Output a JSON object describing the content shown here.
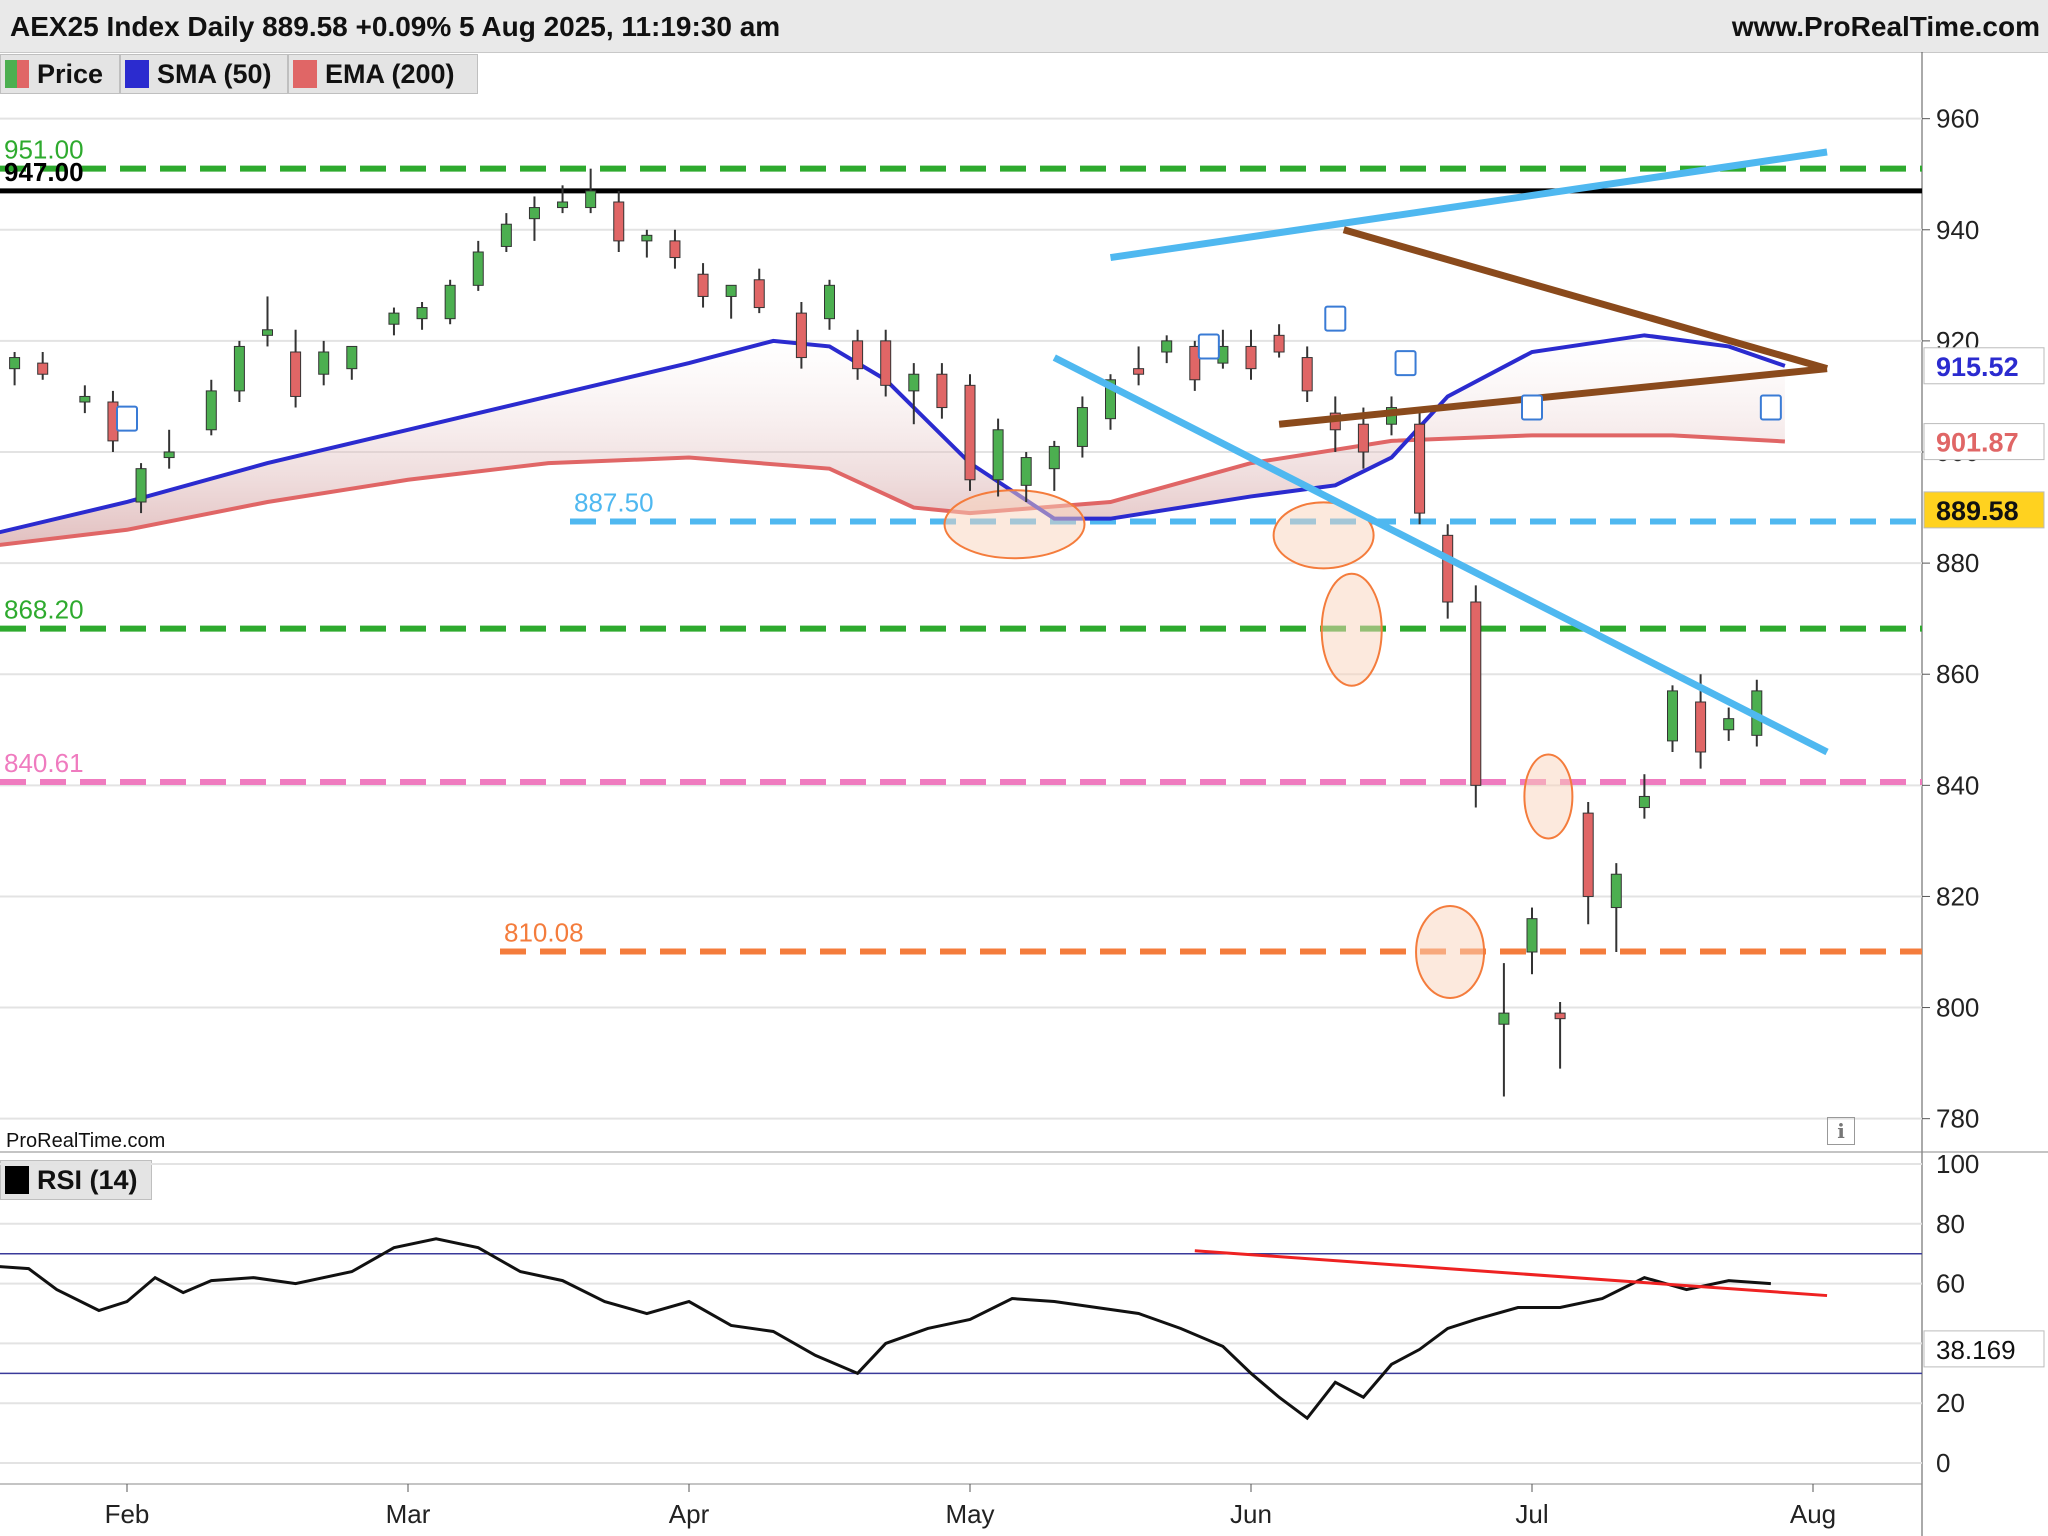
{
  "header": {
    "title": "AEX25 Index Daily 889.58 +0.09% 5 Aug 2025, 11:19:30 am",
    "site": "www.ProRealTime.com"
  },
  "legend": [
    {
      "label": "Price",
      "color": "#4caf50",
      "color2": "#e06666"
    },
    {
      "label": "SMA (50)",
      "color": "#2b2bcf"
    },
    {
      "label": "EMA (200)",
      "color": "#e06666"
    }
  ],
  "rsi_legend": {
    "label": "RSI (14)",
    "color": "#000000"
  },
  "watermark": "ProRealTime.com",
  "info_icon": "i",
  "chart_data": [
    {
      "type": "candlestick",
      "title": "AEX25 Index Daily",
      "x_labels": [
        "Feb",
        "Mar",
        "Apr",
        "May",
        "Jun",
        "Jul",
        "Aug"
      ],
      "y_ticks": [
        780,
        800,
        820,
        840,
        860,
        880,
        900,
        920,
        940,
        960
      ],
      "ylim": [
        774,
        972
      ],
      "last_price": 889.58,
      "price_labels": [
        {
          "value": 915.52,
          "text": "915.52",
          "color": "#2b2bcf"
        },
        {
          "value": 901.87,
          "text": "901.87",
          "color": "#e06666"
        },
        {
          "value": 889.58,
          "text": "889.58",
          "color": "#111111",
          "bg": "#ffd21f"
        }
      ],
      "levels": [
        {
          "value": 951.0,
          "label": "951.00",
          "color": "#2eaa2e",
          "style": "dashed"
        },
        {
          "value": 947.0,
          "label": "947.00",
          "color": "#000000",
          "style": "solid"
        },
        {
          "value": 887.5,
          "label": "887.50",
          "color": "#4fb8f0",
          "style": "dashed"
        },
        {
          "value": 868.2,
          "label": "868.20",
          "color": "#2eaa2e",
          "style": "dashed"
        },
        {
          "value": 840.61,
          "label": "840.61",
          "color": "#ef7bbf",
          "style": "dashed"
        },
        {
          "value": 810.08,
          "label": "810.08",
          "color": "#f47c3c",
          "style": "dashed"
        }
      ],
      "trendlines": [
        {
          "name": "upper channel",
          "color": "#4fb8f0",
          "from": [
            3.5,
            935
          ],
          "to": [
            6.05,
            954
          ]
        },
        {
          "name": "lower channel",
          "color": "#4fb8f0",
          "from": [
            3.3,
            917
          ],
          "to": [
            6.05,
            846
          ]
        },
        {
          "name": "falling triangle side",
          "color": "#8a4a1c",
          "from": [
            4.33,
            940
          ],
          "to": [
            6.05,
            915
          ]
        },
        {
          "name": "rising triangle side",
          "color": "#8a4a1c",
          "from": [
            4.1,
            905
          ],
          "to": [
            6.05,
            915
          ]
        }
      ],
      "sma50": [
        [
          -0.5,
          885
        ],
        [
          0,
          891
        ],
        [
          0.5,
          898
        ],
        [
          1,
          904
        ],
        [
          1.5,
          910
        ],
        [
          2,
          916
        ],
        [
          2.3,
          920
        ],
        [
          2.5,
          919
        ],
        [
          2.7,
          913
        ],
        [
          3,
          898
        ],
        [
          3.3,
          888
        ],
        [
          3.5,
          888
        ],
        [
          4,
          892
        ],
        [
          4.3,
          894
        ],
        [
          4.5,
          899
        ],
        [
          4.7,
          910
        ],
        [
          5,
          918
        ],
        [
          5.4,
          921
        ],
        [
          5.7,
          919
        ],
        [
          5.9,
          915.5
        ]
      ],
      "ema200": [
        [
          -0.5,
          883
        ],
        [
          0,
          886
        ],
        [
          0.5,
          891
        ],
        [
          1,
          895
        ],
        [
          1.5,
          898
        ],
        [
          2,
          899
        ],
        [
          2.5,
          897
        ],
        [
          2.8,
          890
        ],
        [
          3,
          889
        ],
        [
          3.5,
          891
        ],
        [
          4,
          898
        ],
        [
          4.5,
          902
        ],
        [
          5,
          903
        ],
        [
          5.5,
          903
        ],
        [
          5.9,
          901.9
        ]
      ],
      "candles": [
        {
          "x": -0.4,
          "o": 915,
          "h": 918,
          "l": 912,
          "c": 917
        },
        {
          "x": -0.3,
          "o": 916,
          "h": 918,
          "l": 913,
          "c": 914
        },
        {
          "x": -0.15,
          "o": 909,
          "h": 912,
          "l": 907,
          "c": 910
        },
        {
          "x": -0.05,
          "o": 909,
          "h": 911,
          "l": 900,
          "c": 902
        },
        {
          "x": 0.05,
          "o": 891,
          "h": 898,
          "l": 889,
          "c": 897
        },
        {
          "x": 0.15,
          "o": 899,
          "h": 904,
          "l": 897,
          "c": 900
        },
        {
          "x": 0.3,
          "o": 904,
          "h": 913,
          "l": 903,
          "c": 911
        },
        {
          "x": 0.4,
          "o": 911,
          "h": 920,
          "l": 909,
          "c": 919
        },
        {
          "x": 0.5,
          "o": 921,
          "h": 928,
          "l": 919,
          "c": 922
        },
        {
          "x": 0.6,
          "o": 918,
          "h": 922,
          "l": 908,
          "c": 910
        },
        {
          "x": 0.7,
          "o": 914,
          "h": 920,
          "l": 912,
          "c": 918
        },
        {
          "x": 0.8,
          "o": 915,
          "h": 919,
          "l": 913,
          "c": 919
        },
        {
          "x": 0.95,
          "o": 923,
          "h": 926,
          "l": 921,
          "c": 925
        },
        {
          "x": 1.05,
          "o": 924,
          "h": 927,
          "l": 922,
          "c": 926
        },
        {
          "x": 1.15,
          "o": 924,
          "h": 931,
          "l": 923,
          "c": 930
        },
        {
          "x": 1.25,
          "o": 930,
          "h": 938,
          "l": 929,
          "c": 936
        },
        {
          "x": 1.35,
          "o": 937,
          "h": 943,
          "l": 936,
          "c": 941
        },
        {
          "x": 1.45,
          "o": 942,
          "h": 946,
          "l": 938,
          "c": 944
        },
        {
          "x": 1.55,
          "o": 944,
          "h": 948,
          "l": 943,
          "c": 945
        },
        {
          "x": 1.65,
          "o": 944,
          "h": 951,
          "l": 943,
          "c": 947
        },
        {
          "x": 1.75,
          "o": 945,
          "h": 947,
          "l": 936,
          "c": 938
        },
        {
          "x": 1.85,
          "o": 938,
          "h": 940,
          "l": 935,
          "c": 939
        },
        {
          "x": 1.95,
          "o": 938,
          "h": 940,
          "l": 933,
          "c": 935
        },
        {
          "x": 2.05,
          "o": 932,
          "h": 934,
          "l": 926,
          "c": 928
        },
        {
          "x": 2.15,
          "o": 928,
          "h": 930,
          "l": 924,
          "c": 930
        },
        {
          "x": 2.25,
          "o": 931,
          "h": 933,
          "l": 925,
          "c": 926
        },
        {
          "x": 2.4,
          "o": 925,
          "h": 927,
          "l": 915,
          "c": 917
        },
        {
          "x": 2.5,
          "o": 924,
          "h": 931,
          "l": 922,
          "c": 930
        },
        {
          "x": 2.6,
          "o": 920,
          "h": 922,
          "l": 913,
          "c": 915
        },
        {
          "x": 2.7,
          "o": 920,
          "h": 922,
          "l": 910,
          "c": 912
        },
        {
          "x": 2.8,
          "o": 911,
          "h": 916,
          "l": 905,
          "c": 914
        },
        {
          "x": 2.9,
          "o": 914,
          "h": 916,
          "l": 906,
          "c": 908
        },
        {
          "x": 3.0,
          "o": 912,
          "h": 914,
          "l": 893,
          "c": 895
        },
        {
          "x": 3.1,
          "o": 895,
          "h": 906,
          "l": 892,
          "c": 904
        },
        {
          "x": 3.2,
          "o": 894,
          "h": 900,
          "l": 891,
          "c": 899
        },
        {
          "x": 3.3,
          "o": 897,
          "h": 902,
          "l": 893,
          "c": 901
        },
        {
          "x": 3.4,
          "o": 901,
          "h": 910,
          "l": 899,
          "c": 908
        },
        {
          "x": 3.5,
          "o": 906,
          "h": 914,
          "l": 904,
          "c": 913
        },
        {
          "x": 3.6,
          "o": 915,
          "h": 919,
          "l": 912,
          "c": 914
        },
        {
          "x": 3.7,
          "o": 918,
          "h": 921,
          "l": 916,
          "c": 920
        },
        {
          "x": 3.8,
          "o": 919,
          "h": 920,
          "l": 911,
          "c": 913
        },
        {
          "x": 3.9,
          "o": 916,
          "h": 922,
          "l": 915,
          "c": 919
        },
        {
          "x": 4.0,
          "o": 919,
          "h": 922,
          "l": 913,
          "c": 915
        },
        {
          "x": 4.1,
          "o": 921,
          "h": 923,
          "l": 917,
          "c": 918
        },
        {
          "x": 4.2,
          "o": 917,
          "h": 919,
          "l": 909,
          "c": 911
        },
        {
          "x": 4.3,
          "o": 907,
          "h": 910,
          "l": 900,
          "c": 904
        },
        {
          "x": 4.4,
          "o": 905,
          "h": 908,
          "l": 897,
          "c": 900
        },
        {
          "x": 4.5,
          "o": 905,
          "h": 910,
          "l": 903,
          "c": 908
        },
        {
          "x": 4.6,
          "o": 905,
          "h": 908,
          "l": 887,
          "c": 889
        },
        {
          "x": 4.7,
          "o": 885,
          "h": 887,
          "l": 870,
          "c": 873
        },
        {
          "x": 4.8,
          "o": 873,
          "h": 876,
          "l": 836,
          "c": 840
        },
        {
          "x": 4.9,
          "o": 797,
          "h": 808,
          "l": 784,
          "c": 799
        },
        {
          "x": 5.0,
          "o": 810,
          "h": 818,
          "l": 806,
          "c": 816
        },
        {
          "x": 5.1,
          "o": 799,
          "h": 801,
          "l": 789,
          "c": 798
        },
        {
          "x": 5.2,
          "o": 835,
          "h": 837,
          "l": 815,
          "c": 820
        },
        {
          "x": 5.3,
          "o": 818,
          "h": 826,
          "l": 810,
          "c": 824
        },
        {
          "x": 5.4,
          "o": 836,
          "h": 842,
          "l": 834,
          "c": 838
        },
        {
          "x": 5.5,
          "o": 848,
          "h": 858,
          "l": 846,
          "c": 857
        },
        {
          "x": 5.6,
          "o": 855,
          "h": 860,
          "l": 843,
          "c": 846
        },
        {
          "x": 5.7,
          "o": 850,
          "h": 854,
          "l": 848,
          "c": 852
        },
        {
          "x": 5.8,
          "o": 849,
          "h": 859,
          "l": 847,
          "c": 857
        }
      ]
    },
    {
      "type": "line",
      "title": "RSI (14)",
      "y_ticks": [
        0,
        20,
        40,
        60,
        80,
        100
      ],
      "ylim": [
        -5,
        103
      ],
      "overbought": 70,
      "oversold": 30,
      "last_value": 38.169,
      "last_label": "38.169",
      "divergence_line": {
        "color": "#ee2222",
        "from": [
          3.8,
          71
        ],
        "to": [
          6.05,
          56
        ]
      },
      "values": [
        [
          -0.5,
          66
        ],
        [
          -0.35,
          65
        ],
        [
          -0.25,
          58
        ],
        [
          -0.1,
          51
        ],
        [
          0,
          54
        ],
        [
          0.1,
          62
        ],
        [
          0.2,
          57
        ],
        [
          0.3,
          61
        ],
        [
          0.45,
          62
        ],
        [
          0.6,
          60
        ],
        [
          0.8,
          64
        ],
        [
          0.95,
          72
        ],
        [
          1.1,
          75
        ],
        [
          1.25,
          72
        ],
        [
          1.4,
          64
        ],
        [
          1.55,
          61
        ],
        [
          1.7,
          54
        ],
        [
          1.85,
          50
        ],
        [
          2.0,
          54
        ],
        [
          2.15,
          46
        ],
        [
          2.3,
          44
        ],
        [
          2.45,
          36
        ],
        [
          2.6,
          30
        ],
        [
          2.7,
          40
        ],
        [
          2.85,
          45
        ],
        [
          3.0,
          48
        ],
        [
          3.15,
          55
        ],
        [
          3.3,
          54
        ],
        [
          3.45,
          52
        ],
        [
          3.6,
          50
        ],
        [
          3.75,
          45
        ],
        [
          3.9,
          39
        ],
        [
          4.0,
          30
        ],
        [
          4.1,
          22
        ],
        [
          4.2,
          15
        ],
        [
          4.3,
          27
        ],
        [
          4.4,
          22
        ],
        [
          4.5,
          33
        ],
        [
          4.6,
          38
        ],
        [
          4.7,
          45
        ],
        [
          4.8,
          48
        ],
        [
          4.95,
          52
        ],
        [
          5.1,
          52
        ],
        [
          5.25,
          55
        ],
        [
          5.4,
          62
        ],
        [
          5.55,
          58
        ],
        [
          5.7,
          61
        ],
        [
          5.85,
          60
        ]
      ]
    }
  ]
}
